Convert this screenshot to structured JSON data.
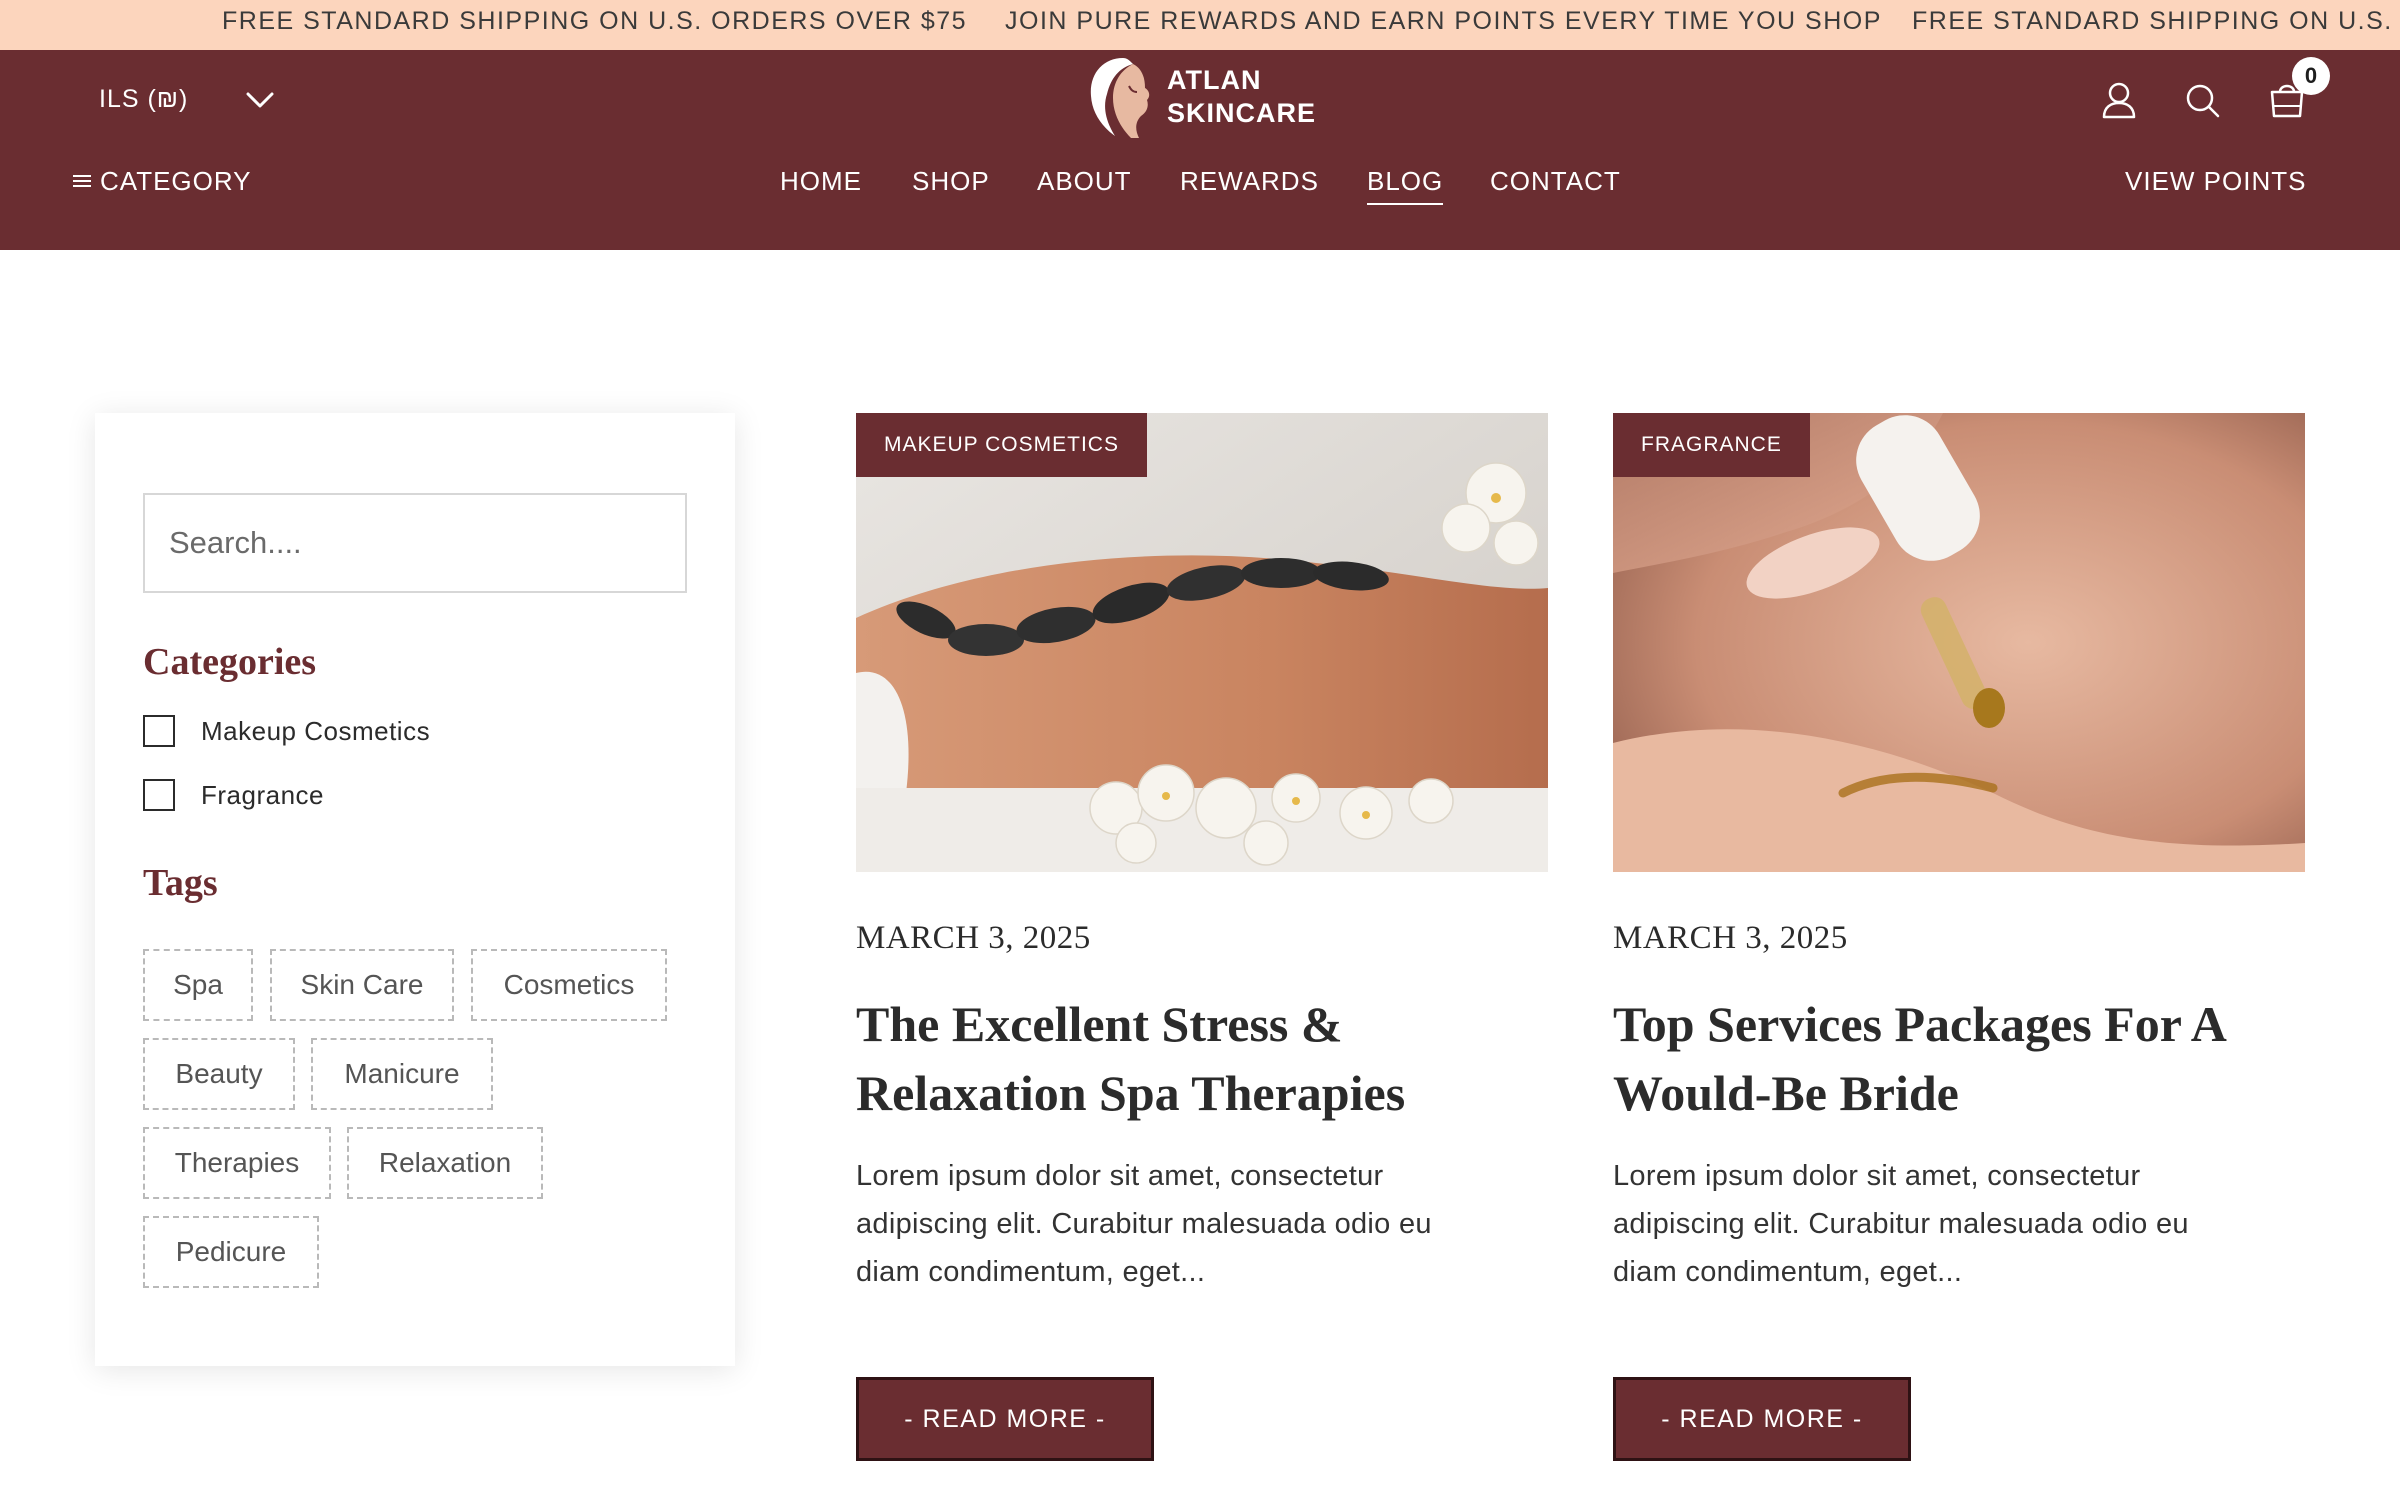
{
  "announcement": {
    "items": [
      "FREE STANDARD SHIPPING ON U.S. ORDERS OVER $75",
      "JOIN PURE REWARDS AND EARN POINTS EVERY TIME YOU SHOP",
      "FREE STANDARD SHIPPING ON U.S. OR"
    ]
  },
  "header": {
    "currency": "ILS (₪)",
    "logo_line1": "ATLAN",
    "logo_line2": "SKINCARE",
    "cart_count": "0",
    "category_label": "CATEGORY",
    "nav": [
      "HOME",
      "SHOP",
      "ABOUT",
      "REWARDS",
      "BLOG",
      "CONTACT"
    ],
    "active_nav": "BLOG",
    "view_points": "VIEW POINTS",
    "icons": [
      "chevron-down-icon",
      "user-icon",
      "search-icon",
      "cart-icon",
      "hamburger-icon"
    ]
  },
  "sidebar": {
    "search_placeholder": "Search....",
    "categories_heading": "Categories",
    "categories": [
      "Makeup Cosmetics",
      "Fragrance"
    ],
    "tags_heading": "Tags",
    "tags": [
      "Spa",
      "Skin Care",
      "Cosmetics",
      "Beauty",
      "Manicure",
      "Therapies",
      "Relaxation",
      "Pedicure"
    ]
  },
  "posts": [
    {
      "category": "MAKEUP COSMETICS",
      "date": "MARCH 3, 2025",
      "title": "The Excellent Stress & Relaxation Spa Therapies",
      "excerpt": "Lorem ipsum dolor sit amet, consectetur adipiscing elit. Curabitur malesuada odio eu diam condimentum, eget...",
      "button": "- READ MORE -"
    },
    {
      "category": "FRAGRANCE",
      "date": "MARCH 3, 2025",
      "title": "Top Services Packages For A Would-Be Bride",
      "excerpt": "Lorem ipsum dolor sit amet, consectetur adipiscing elit. Curabitur malesuada odio eu diam condimentum, eget...",
      "button": "- READ MORE -"
    }
  ],
  "colors": {
    "announcement_bg": "#fcd5bd",
    "brand": "#6a2d31",
    "text": "#2b2b2b"
  }
}
